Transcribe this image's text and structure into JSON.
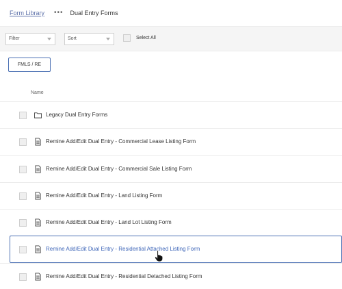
{
  "breadcrumb": {
    "root": "Form Library",
    "more": "•••",
    "current": "Dual Entry Forms"
  },
  "toolbar": {
    "filter_label": "Filter",
    "sort_label": "Sort",
    "select_all_label": "Select All"
  },
  "tag": {
    "label": "FMLS / RE"
  },
  "list": {
    "column_name": "Name",
    "items": [
      {
        "label": "Legacy Dual Entry Forms",
        "icon": "folder-icon"
      },
      {
        "label": "Remine Add/Edit Dual Entry - Commercial Lease Listing Form",
        "icon": "document-icon"
      },
      {
        "label": "Remine Add/Edit Dual Entry - Commercial Sale Listing Form",
        "icon": "document-icon"
      },
      {
        "label": "Remine Add/Edit Dual Entry - Land Listing Form",
        "icon": "document-icon"
      },
      {
        "label": "Remine Add/Edit Dual Entry - Land Lot Listing Form",
        "icon": "document-icon"
      },
      {
        "label": "Remine Add/Edit Dual Entry - Residential Attached Listing Form",
        "icon": "document-icon"
      },
      {
        "label": "Remine Add/Edit Dual Entry - Residential Detached Listing Form",
        "icon": "document-icon"
      }
    ]
  },
  "colors": {
    "accent": "#3d65b8",
    "link": "#5b6fa8",
    "toolbar_bg": "#f5f5f5"
  }
}
